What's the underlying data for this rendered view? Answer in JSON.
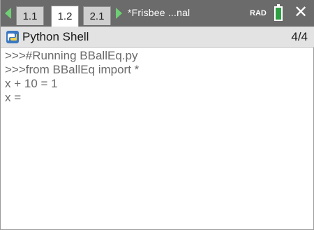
{
  "tabs": [
    {
      "label": "1.1",
      "active": false
    },
    {
      "label": "1.2",
      "active": true
    },
    {
      "label": "2.1",
      "active": false
    }
  ],
  "document_title": "*Frisbee ...nal",
  "angle_mode": "RAD",
  "header": {
    "app_name": "Python Shell",
    "page_count": "4/4"
  },
  "shell_lines": [
    ">>>#Running BBallEq.py",
    ">>>from BBallEq import *",
    "x + 10 = 1",
    "x ="
  ],
  "icons": {
    "tab_left": "left-arrow-icon",
    "tab_right": "right-arrow-icon",
    "battery": "battery-icon",
    "close": "close-icon",
    "python": "python-icon"
  },
  "colors": {
    "tabbar": "#6b6b6b",
    "accent_green": "#6fcf74",
    "battery_green": "#2ea043"
  }
}
